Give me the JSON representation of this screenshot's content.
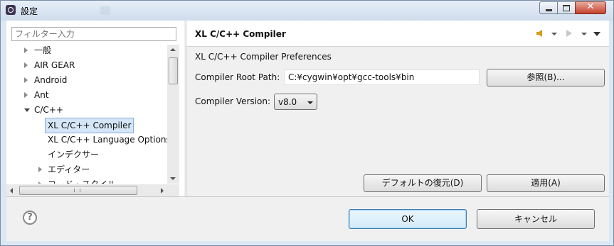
{
  "window": {
    "title": "設定"
  },
  "filter": {
    "placeholder": "フィルター入力"
  },
  "tree": [
    {
      "label": "一般",
      "state": "closed"
    },
    {
      "label": "AIR GEAR",
      "state": "closed"
    },
    {
      "label": "Android",
      "state": "closed"
    },
    {
      "label": "Ant",
      "state": "closed"
    },
    {
      "label": "C/C++",
      "state": "open"
    },
    {
      "label": "XL C/C++ Compiler",
      "state": "leaf",
      "selected": true
    },
    {
      "label": "XL C/C++ Language Options",
      "state": "leaf"
    },
    {
      "label": "インデクサー",
      "state": "leaf"
    },
    {
      "label": "エディター",
      "state": "closed"
    },
    {
      "label": "コード・スタイル",
      "state": "closed"
    }
  ],
  "page": {
    "title": "XL C/C++ Compiler",
    "description": "XL C/C++ Compiler Preferences",
    "root_path_label": "Compiler Root Path:",
    "root_path_value": "C:¥cygwin¥opt¥gcc-tools¥bin",
    "browse_label": "参照(B)...",
    "version_label": "Compiler Version:",
    "version_value": "v8.0",
    "restore_defaults_label": "デフォルトの復元(D)",
    "apply_label": "適用(A)"
  },
  "footer": {
    "ok_label": "OK",
    "cancel_label": "キャンセル",
    "help_glyph": "?"
  }
}
